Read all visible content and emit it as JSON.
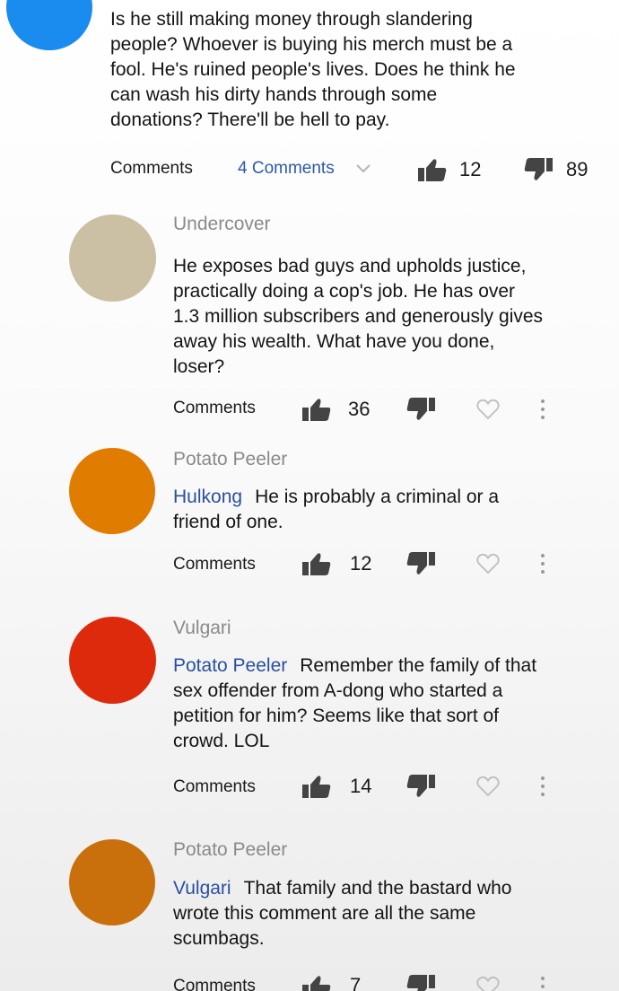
{
  "top_comment": {
    "text": "Is he still making money through slandering people? Whoever is buying his merch must be a fool. He's ruined people's lives. Does he think he can wash his dirty hands through some donations? There'll be hell to pay.",
    "comments_label": "Comments",
    "replies_link": "4 Comments",
    "likes": "12",
    "dislikes": "89",
    "avatar_color": "#1a8cf0"
  },
  "replies": [
    {
      "author": "Undercover",
      "mention": "",
      "text": "He exposes bad guys and upholds justice, practically doing a cop's job. He has over 1.3 million subscribers and generously gives away his wealth. What have you done, loser?",
      "comments_label": "Comments",
      "likes": "36",
      "avatar_color": "#cbbfa4"
    },
    {
      "author": "Potato Peeler",
      "mention": "Hulkong",
      "text": "He is probably a criminal or a friend of one.",
      "comments_label": "Comments",
      "likes": "12",
      "avatar_color": "#e07c00"
    },
    {
      "author": "Vulgari",
      "mention": "Potato Peeler",
      "text": "Remember the family of that sex offender from A-dong who started a petition for him? Seems like that sort of crowd. LOL",
      "comments_label": "Comments",
      "likes": "14",
      "avatar_color": "#dd2a0c"
    },
    {
      "author": "Potato Peeler",
      "mention": "Vulgari",
      "text": "That family and the bastard who wrote this comment are all the same scumbags.",
      "comments_label": "Comments",
      "likes": "7",
      "avatar_color": "#c9700c"
    }
  ],
  "icons": {
    "like": "thumbs-up-icon",
    "dislike": "thumbs-down-icon",
    "heart": "heart-icon",
    "more": "more-vertical-icon",
    "chevron": "chevron-down-icon"
  }
}
